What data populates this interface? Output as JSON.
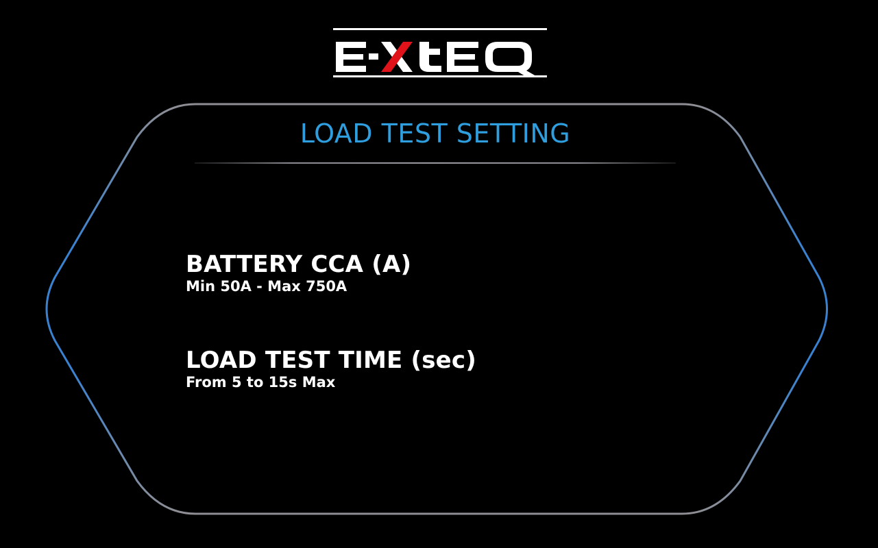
{
  "logo": {
    "text": "E-XTEQ",
    "colors": {
      "primary": "#ffffff",
      "accent": "#e0131a"
    }
  },
  "screen": {
    "title": "LOAD TEST SETTING",
    "title_color": "#2f9ede",
    "frame_colors": {
      "top": "#8e8e94",
      "middle": "#3a82d0",
      "bottom": "#8e8e94"
    }
  },
  "settings": [
    {
      "label": "BATTERY CCA (A)",
      "hint": "Min 50A - Max 750A"
    },
    {
      "label": "LOAD TEST TIME (sec)",
      "hint": "From 5 to 15s Max"
    }
  ]
}
